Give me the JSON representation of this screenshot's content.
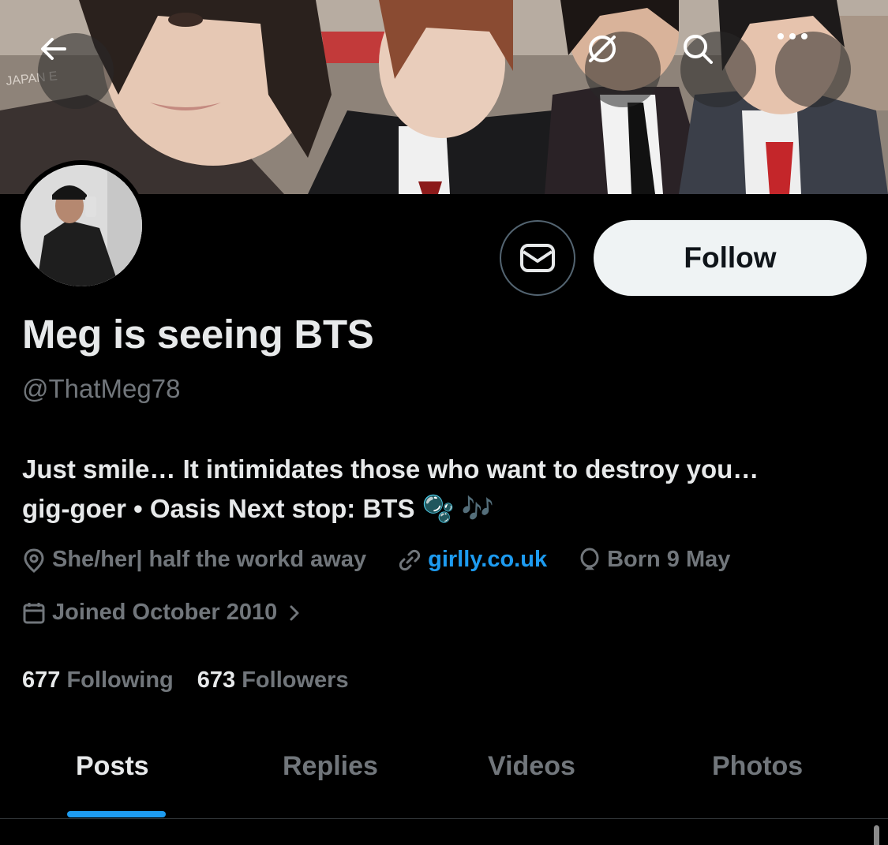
{
  "header": {
    "back_icon": "arrow-left-icon",
    "unblock_icon": "no-sign-icon",
    "search_icon": "search-icon",
    "more_icon": "more-horizontal-icon",
    "banner_sign_text": "JAPAN E"
  },
  "profile": {
    "display_name": "Meg is seeing BTS",
    "handle": "@ThatMeg78",
    "bio_line1": "Just smile… It intimidates those who want to destroy you…",
    "bio_line2": "gig-goer • Oasis Next stop: BTS",
    "bio_emoji": "🫧 🎶",
    "location": "She/her| half the workd away",
    "website": "girlly.co.uk",
    "birthday": "Born 9 May",
    "joined": "Joined October 2010",
    "following_count": "677",
    "following_label": "Following",
    "followers_count": "673",
    "followers_label": "Followers"
  },
  "actions": {
    "message_icon": "envelope-icon",
    "follow_label": "Follow"
  },
  "tabs": [
    {
      "label": "Posts",
      "active": true
    },
    {
      "label": "Replies",
      "active": false
    },
    {
      "label": "Videos",
      "active": false
    },
    {
      "label": "Photos",
      "active": false
    }
  ],
  "colors": {
    "background": "#000000",
    "accent": "#1d9bf0",
    "secondary_text": "#71767b",
    "primary_text": "#e7e9ea",
    "follow_button_bg": "#eff3f4"
  }
}
